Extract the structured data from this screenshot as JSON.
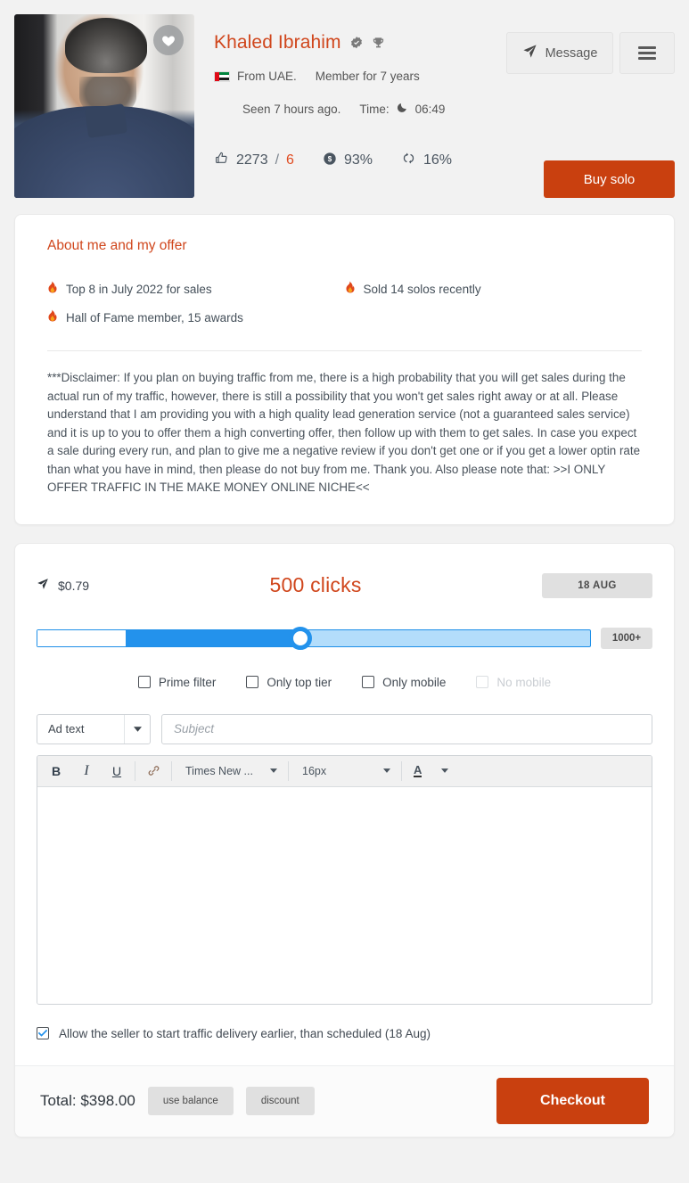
{
  "seller": {
    "name": "Khaled Ibrahim",
    "verified_icon": "verified-badge-icon",
    "trophy_icon": "trophy-icon",
    "favorite_icon": "heart-icon",
    "avatar_alt": "seller-avatar-photo",
    "country_flag": "uae-flag-icon",
    "from_text": "From UAE.",
    "membership": "Member for 7 years",
    "seen": "Seen 7 hours ago.",
    "time_label": "Time:",
    "time_icon": "moon-icon",
    "time_value": "06:49",
    "stats": {
      "rating_icon": "thumbs-up-icon",
      "rating_positive": "2273",
      "rating_slash": "/",
      "rating_negative": "6",
      "sales_icon": "dollar-coin-icon",
      "sales_value": "93%",
      "repeat_icon": "repeat-arrows-icon",
      "repeat_value": "16%"
    },
    "message_button": "Message",
    "message_icon": "paper-plane-icon",
    "menu_icon": "hamburger-menu-icon",
    "buy_button": "Buy solo"
  },
  "about": {
    "title": "About me and my offer",
    "highlights": [
      {
        "icon": "flame-icon",
        "text": "Top 8 in July 2022 for sales"
      },
      {
        "icon": "flame-icon",
        "text": "Sold 14 solos recently"
      },
      {
        "icon": "flame-icon",
        "text": "Hall of Fame member, 15 awards"
      }
    ],
    "disclaimer": "***Disclaimer: If you plan on buying traffic from me, there is a high probability that you will get sales during the actual run of my traffic, however, there is still a possibility that you won't get sales right away or at all. Please understand that I am providing you with a high quality lead generation service (not a guaranteed sales service) and it is up to you to offer them a high converting offer, then follow up with them to get sales. In case you expect a sale during every run, and plan to give me a negative review if you don't get one or if you get a lower optin rate than what you have in mind, then please do not buy from me. Thank you. Also please note that: >>I ONLY OFFER TRAFFIC IN THE MAKE MONEY ONLINE NICHE<<"
  },
  "order": {
    "price_icon": "paper-plane-icon",
    "price_per_click": "$0.79",
    "clicks_title": "500 clicks",
    "date_chip": "18 AUG",
    "slider_max_chip": "1000+",
    "filters": [
      {
        "label": "Prime filter",
        "checked": false,
        "disabled": false
      },
      {
        "label": "Only top tier",
        "checked": false,
        "disabled": false
      },
      {
        "label": "Only mobile",
        "checked": false,
        "disabled": false
      },
      {
        "label": "No mobile",
        "checked": false,
        "disabled": true
      }
    ],
    "ad_text_select": "Ad text",
    "subject_value": "",
    "subject_placeholder": "Subject",
    "editor": {
      "bold_icon": "bold-icon",
      "bold_label": "B",
      "italic_icon": "italic-icon",
      "italic_label": "I",
      "underline_icon": "underline-icon",
      "underline_label": "U",
      "link_icon": "link-icon",
      "font_family": "Times New ...",
      "font_size": "16px",
      "font_color_label": "A",
      "body_value": ""
    },
    "allow_early": {
      "checked": true,
      "label": "Allow the seller to start traffic delivery earlier, than scheduled (18 Aug)"
    },
    "footer": {
      "total": "Total: $398.00",
      "use_balance": "use balance",
      "discount": "discount",
      "checkout": "Checkout"
    }
  },
  "colors": {
    "accent_orange": "#c9400f",
    "heading_orange": "#d0461c",
    "slider_blue": "#2392ec",
    "slider_track_light": "#b3ddfb"
  }
}
